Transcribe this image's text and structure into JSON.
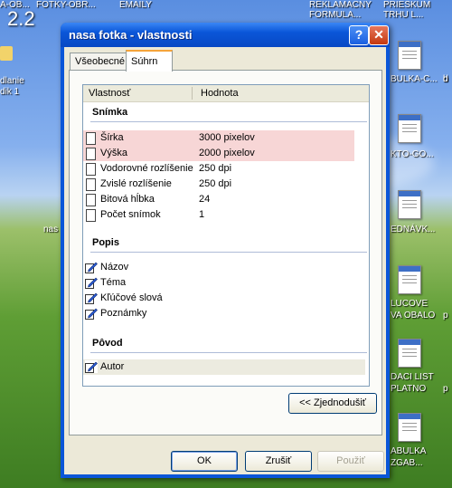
{
  "desktop": {
    "version_text": "2.2",
    "top_labels": [
      "A-OB...",
      "FOTKY-OBR...",
      "EMAILY",
      "REKLAMACNY FORMULA...",
      "PRIESKUM TRHU L..."
    ],
    "left_labels": [
      "dlanie",
      "dik 1"
    ],
    "right_labels": [
      "BULKA-C...",
      "d",
      "KTO-GO...",
      "EDNÁVK...",
      "LUCOVE",
      "VA OBALO",
      "DACI LIST",
      "PLATNO",
      "ABULKA",
      "ZGAB..."
    ],
    "other_labels": [
      "nas",
      "b",
      "p",
      "p"
    ]
  },
  "window": {
    "title": "nasa fotka - vlastnosti",
    "help_glyph": "?",
    "close_glyph": "✕",
    "tabs": [
      "Všeobecné",
      "Súhrn"
    ],
    "active_tab": "Súhrn",
    "columns": [
      "Vlastnosť",
      "Hodnota"
    ],
    "sections": {
      "image": {
        "title": "Snímka",
        "rows": [
          {
            "name": "Šírka",
            "value": "3000 pixelov"
          },
          {
            "name": "Výška",
            "value": "2000 pixelov"
          },
          {
            "name": "Vodorovné rozlíšenie",
            "value": "250 dpi"
          },
          {
            "name": "Zvislé rozlíšenie",
            "value": "250 dpi"
          },
          {
            "name": "Bitová hĺbka",
            "value": "24"
          },
          {
            "name": "Počet snímok",
            "value": "1"
          }
        ]
      },
      "desc": {
        "title": "Popis",
        "rows": [
          {
            "name": "Názov"
          },
          {
            "name": "Téma"
          },
          {
            "name": "Kľúčové slová"
          },
          {
            "name": "Poznámky"
          }
        ]
      },
      "origin": {
        "title": "Pôvod",
        "rows": [
          {
            "name": "Autor"
          }
        ]
      }
    },
    "simplify_button": "<< Zjednodušiť",
    "buttons": {
      "ok": "OK",
      "cancel": "Zrušiť",
      "apply": "Použiť"
    }
  }
}
